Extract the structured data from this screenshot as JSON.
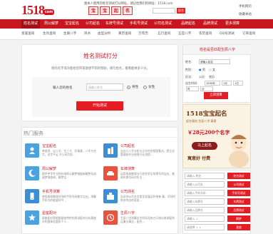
{
  "header": {
    "logo_number": "1518",
    "logo_suffix": "com",
    "notice": "版本人使用的姓名测试打分网址，请记住我们的网址：1518.com",
    "baby_banner": [
      "宝",
      "宝",
      "起",
      "名"
    ],
    "baby_input_placeholder": "",
    "baby_go": "起名",
    "mobile_link": "手机网页",
    "favorite_link": "收藏本站"
  },
  "nav": {
    "items": [
      "姓名测试",
      "周公解梦",
      "宝宝起名",
      "公司起名",
      "车牌号测试",
      "手机号测试",
      "公司名测试",
      "品牌起名",
      "品牌测试",
      "更多测算"
    ]
  },
  "subnav": {
    "items": [
      "星座查询",
      "生肖查询",
      "生辰八字",
      "风水",
      "血型分析",
      "黄历查询",
      "万年历",
      "五行查询",
      "五官八字",
      "农历查询",
      "QQ号测试",
      "订单查询"
    ]
  },
  "main": {
    "title": "姓名测试打分",
    "desc": "财的名字或许能给您带来意想不到的帮助，填写姓名，看看能拼多少分。",
    "name_label": "输入您的姓名",
    "name_placeholder": "请输入姓名",
    "gender_male": "男性",
    "gender_female": "女性",
    "submit": "开始测试"
  },
  "hot": {
    "heading": "热门服务",
    "services": [
      {
        "title": "宝宝起名",
        "desc": "养育您、出八字、生三才、好寓意，八字与名字，名字不足 开父母为您…",
        "color": "#4aa3df",
        "icon": "baby-icon"
      },
      {
        "title": "公司起名",
        "desc": "吉凶人八字分析与企业综合相配看点，是企业管理获开业经营开业流程…",
        "color": "#3c8fd6",
        "icon": "building-icon"
      },
      {
        "title": "周公解梦",
        "desc": "提供中华专业的在线周公解梦根据新解梦及成造梦境查询，解梦吉…",
        "color": "#4aa3df",
        "icon": "moon-icon"
      },
      {
        "title": "车牌测算",
        "desc": "运用周易数理五行综合学后车牌号的吉凶，查询车牌号码对车主…",
        "color": "#e9523c",
        "icon": "car-icon"
      },
      {
        "title": "手机号测算",
        "desc": "使用周易数理对你的手机号码数字吉凶，测算手机号的能量好坏…",
        "color": "#3c8fd6",
        "icon": "phone-icon"
      },
      {
        "title": "公司测名",
        "desc": "告诉你公司名字是否发展吉利带来 事，可同时结合你出的家居…",
        "color": "#3c8fd6",
        "icon": "company-icon"
      },
      {
        "title": "星座配对",
        "desc": "星座配对是根据星座特性的测试配对分析星座对的整体恋爱和个人…",
        "color": "#4aa3df",
        "icon": "star-icon"
      },
      {
        "title": "生辰八字",
        "desc": "生辰八字测算出生时间及各五行排出来测配命运事业事业，配合…",
        "color": "#e9523c",
        "icon": "bazi-icon"
      }
    ]
  },
  "bazi": {
    "title": "姓名是否匹配生辰八字",
    "name_label": "姓名：",
    "name_placeholder": "请输入姓名",
    "gender_label": "性别：",
    "male": "男",
    "female": "女",
    "calendar_label": "历法：",
    "calendar_solar": "公历",
    "calendar_lunar": "农历",
    "birth_label": "出生时间：",
    "year": "1990年",
    "month": "1月",
    "day": "1日",
    "hour": "时",
    "minute": "分",
    "submit": "立即测算"
  },
  "ad": {
    "line1": "1518宝宝起名",
    "line2": "起名服务·生辰八字·寓意",
    "line3": "￥28元200个名字",
    "button": "马上起名",
    "line5": "寓意好 付费"
  },
  "rform": {
    "rows": [
      {
        "input": "请输入 姓名",
        "button": "姓名测试"
      },
      {
        "input": "请输入公司名",
        "button": "公司测试"
      },
      {
        "input": "请输入手机号码",
        "button": "手机号测试"
      },
      {
        "input": "请输入车牌号",
        "button": "车牌测试"
      },
      {
        "input": "请输入品牌名",
        "button": "品牌测试"
      },
      {
        "input": "请输入 ↓",
        "button": "解梦"
      },
      {
        "input": "请选择 ↓  ↓",
        "button": "星座"
      }
    ]
  }
}
